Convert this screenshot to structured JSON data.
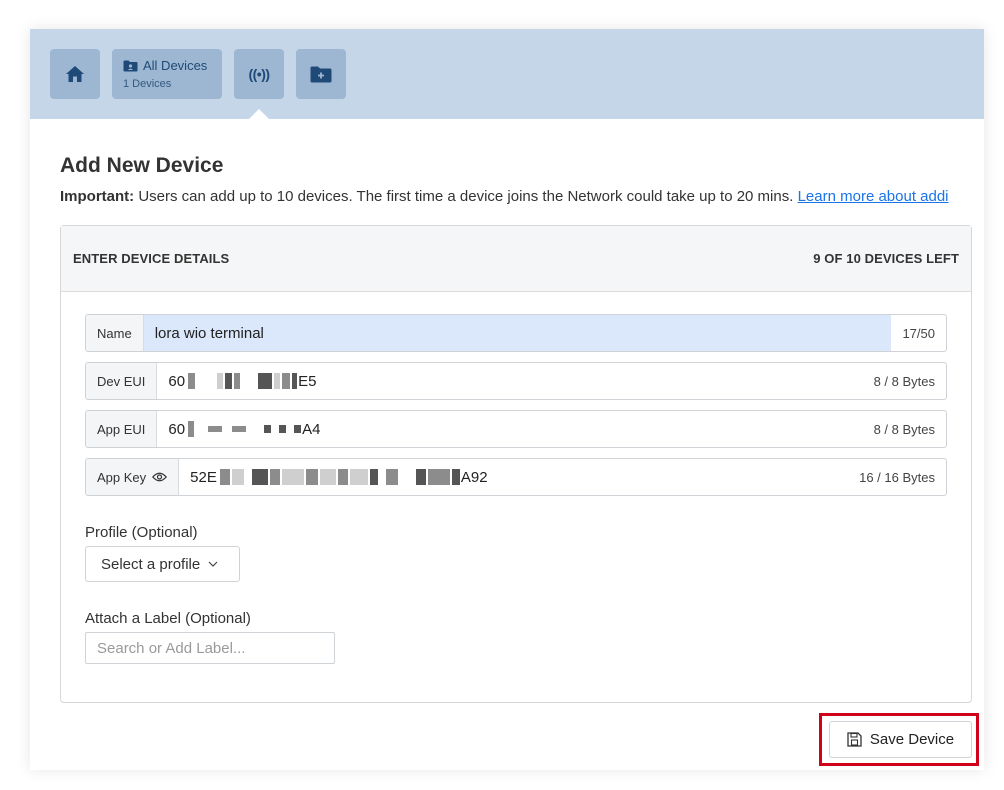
{
  "nav": {
    "all_devices_label": "All Devices",
    "all_devices_count": "1 Devices",
    "signal_glyph": "((•))"
  },
  "page": {
    "title": "Add New Device",
    "notice_bold": "Important:",
    "notice_text": " Users can add up to 10 devices. The first time a device joins the Network could take up to 20 mins. ",
    "notice_link": "Learn more about addi"
  },
  "card": {
    "header_left": "ENTER DEVICE DETAILS",
    "header_right": "9 OF 10 DEVICES LEFT"
  },
  "fields": {
    "name": {
      "label": "Name",
      "value": "lora wio terminal",
      "count": "17/50"
    },
    "dev_eui": {
      "label": "Dev EUI",
      "prefix": "60",
      "suffix": "E5",
      "count": "8 / 8 Bytes"
    },
    "app_eui": {
      "label": "App EUI",
      "prefix": "60",
      "suffix": "A4",
      "count": "8 / 8 Bytes"
    },
    "app_key": {
      "label": "App Key",
      "prefix": "52E",
      "suffix": "A92",
      "count": "16 / 16 Bytes"
    }
  },
  "profile": {
    "label": "Profile (Optional)",
    "select_value": "Select a profile"
  },
  "label_section": {
    "label": "Attach a Label (Optional)",
    "placeholder": "Search or Add Label..."
  },
  "actions": {
    "save_label": "Save Device"
  },
  "colors": {
    "topbar": "#c5d6e8",
    "nav_button": "#9db7d2",
    "link": "#1a73e8",
    "highlight": "#d0021b"
  }
}
